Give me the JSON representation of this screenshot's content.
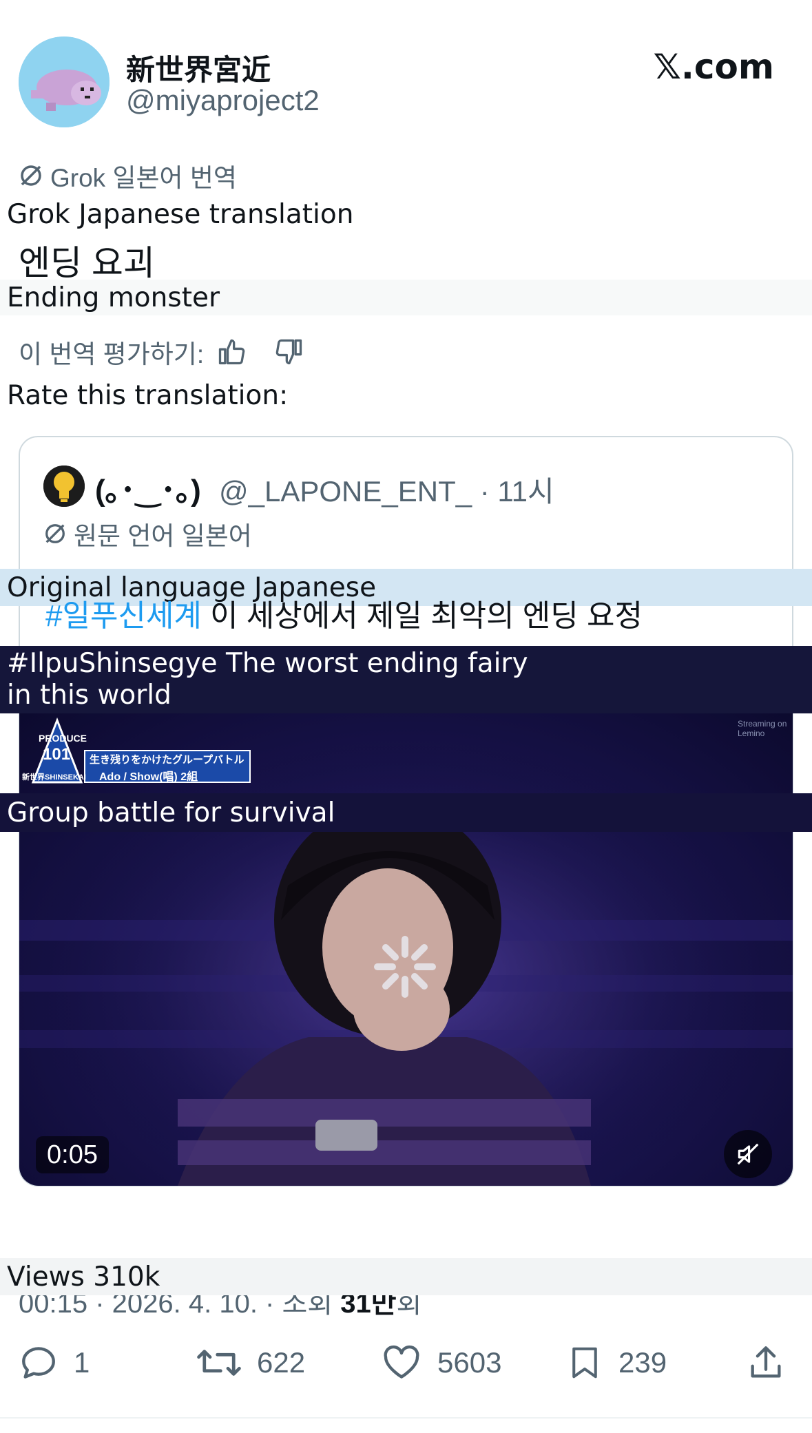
{
  "header": {
    "display_name": "新世界宮近",
    "handle": "@miyaproject2",
    "brand": "𝕏.com"
  },
  "grok": {
    "label": "Grok 일본어 번역",
    "caption": "Grok Japanese translation"
  },
  "tweet": {
    "text": "엔딩 요괴",
    "caption": "Ending monster"
  },
  "rating": {
    "label": "이 번역 평가하기:",
    "caption": "Rate this translation:"
  },
  "quote": {
    "name": "(｡･‿･｡)",
    "handle_time": "@_LAPONE_ENT_ · 11시",
    "original_language": "원문 언어 일본어",
    "original_language_caption": "Original language Japanese",
    "hashtag": "#일푸신세계",
    "text": " 이 세상에서 제일 최악의 엔딩 요정",
    "text_caption_line1": "#IlpuShinsegye The worst ending fairy",
    "text_caption_line2": "in this world"
  },
  "video": {
    "logo_title": "PRODUCE",
    "logo_number": "101",
    "logo_sub": "新世界SHINSEKAI",
    "banner_line1": "生き残りをかけたグループバトル",
    "banner_line2": "Ado / Show(唱) 2組",
    "banner_caption": "Group battle for survival",
    "watermark": "Streaming on Lemino",
    "duration": "0:05"
  },
  "meta": {
    "timestamp_prefix": "00:15 · 2026. 4. 10. · 조회 ",
    "views": "31만",
    "views_suffix": "회",
    "views_caption": "Views 310k"
  },
  "actions": {
    "replies": "1",
    "reposts": "622",
    "likes": "5603",
    "bookmarks": "239"
  },
  "colors": {
    "link": "#1d9bf0",
    "secondary_text": "#536471",
    "primary_text": "#0f1419",
    "border": "#cfd9de"
  }
}
